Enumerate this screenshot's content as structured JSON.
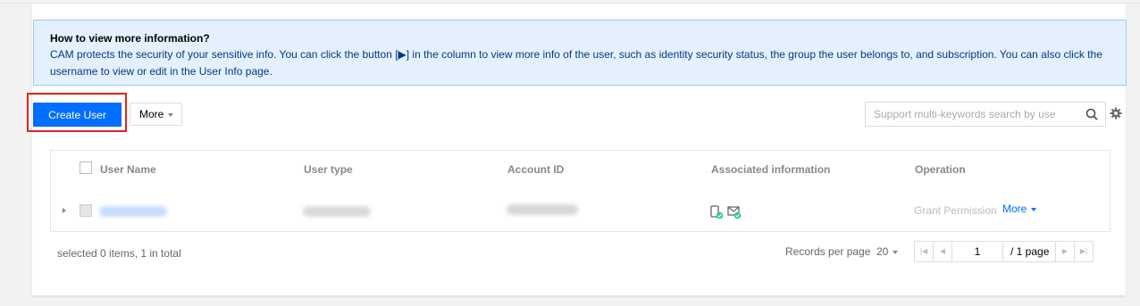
{
  "notice": {
    "title": "How to view more information?",
    "body": "CAM protects the security of your sensitive info. You can click the button [▶] in the column to view more info of the user, such as identity security status, the group the user belongs to, and subscription. You can also click the username to view or edit in the User Info page."
  },
  "toolbar": {
    "create_label": "Create User",
    "more_label": "More"
  },
  "search": {
    "placeholder": "Support multi-keywords search by use"
  },
  "table": {
    "columns": [
      "User Name",
      "User type",
      "Account ID",
      "Associated information",
      "Operation"
    ],
    "rows": [
      {
        "user_name": "",
        "user_type": "",
        "account_id": "",
        "associated_icons": [
          "phone-verified-icon",
          "email-verified-icon"
        ],
        "op_grant": "Grant Permission",
        "op_more": "More"
      }
    ]
  },
  "footer": {
    "selection": "selected 0 items, 1 in total",
    "records_label": "Records per page",
    "records_value": "20",
    "page_value": "1",
    "page_total": "/ 1 page"
  },
  "colors": {
    "primary": "#006eff",
    "notice_bg": "#e5f0ff",
    "highlight": "#e1241a",
    "verified": "#29cc85"
  }
}
